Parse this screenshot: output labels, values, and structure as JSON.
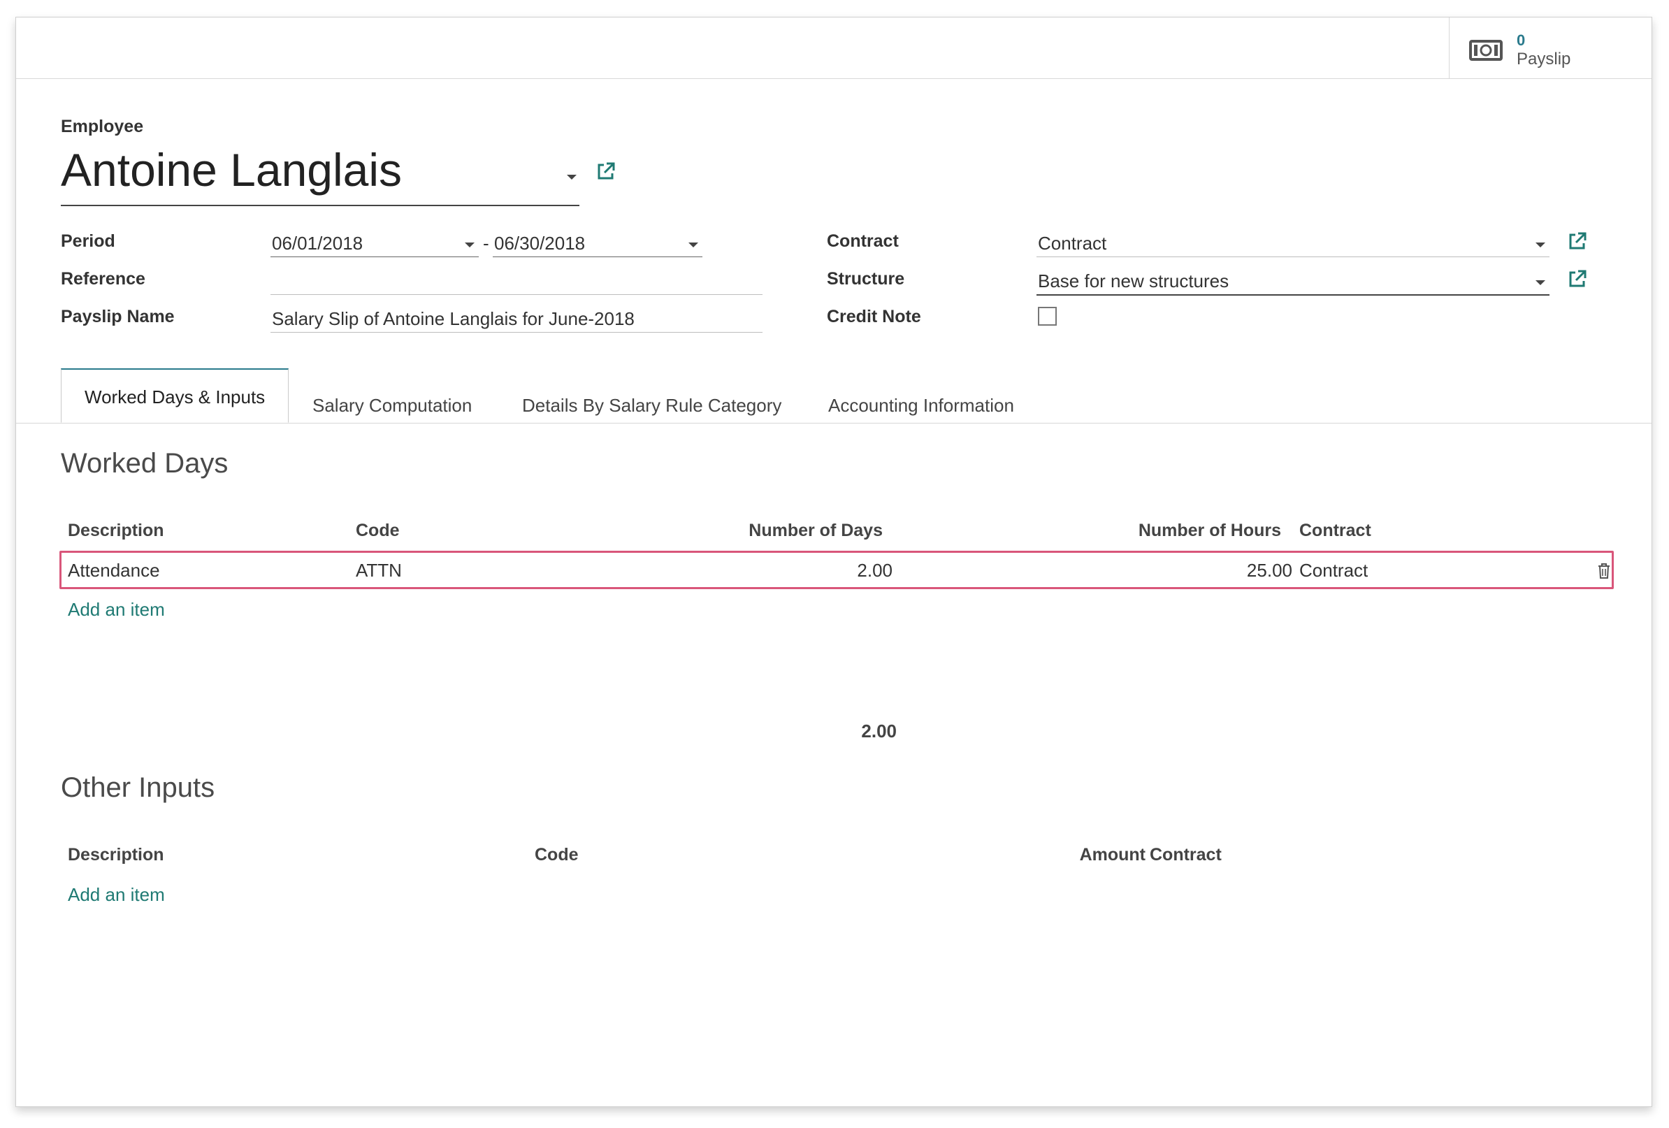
{
  "smart_button": {
    "count": "0",
    "label": "Payslip",
    "icon": "money-icon"
  },
  "employee": {
    "label": "Employee",
    "name": "Antoine Langlais"
  },
  "fields": {
    "period_label": "Period",
    "period_from": "06/01/2018",
    "period_separator": "-",
    "period_to": "06/30/2018",
    "reference_label": "Reference",
    "reference_value": "",
    "payslip_name_label": "Payslip Name",
    "payslip_name_value": "Salary Slip of Antoine Langlais for June-2018",
    "contract_label": "Contract",
    "contract_value": "Contract",
    "structure_label": "Structure",
    "structure_value": "Base for new structures",
    "credit_note_label": "Credit Note",
    "credit_note_checked": false
  },
  "tabs": [
    {
      "label": "Worked Days & Inputs",
      "active": true
    },
    {
      "label": "Salary Computation",
      "active": false
    },
    {
      "label": "Details By Salary Rule Category",
      "active": false
    },
    {
      "label": "Accounting Information",
      "active": false
    }
  ],
  "worked_days": {
    "title": "Worked Days",
    "headers": {
      "description": "Description",
      "code": "Code",
      "days": "Number of Days",
      "hours": "Number of Hours",
      "contract": "Contract"
    },
    "rows": [
      {
        "description": "Attendance",
        "code": "ATTN",
        "days": "2.00",
        "hours": "25.00",
        "contract": "Contract"
      }
    ],
    "add_item": "Add an item",
    "total_days": "2.00"
  },
  "other_inputs": {
    "title": "Other Inputs",
    "headers": {
      "description": "Description",
      "code": "Code",
      "amount": "Amount",
      "contract": "Contract"
    },
    "add_item": "Add an item"
  },
  "colors": {
    "accent": "#2a7a8c",
    "link": "#1f7a73",
    "highlight": "#d9567a"
  }
}
